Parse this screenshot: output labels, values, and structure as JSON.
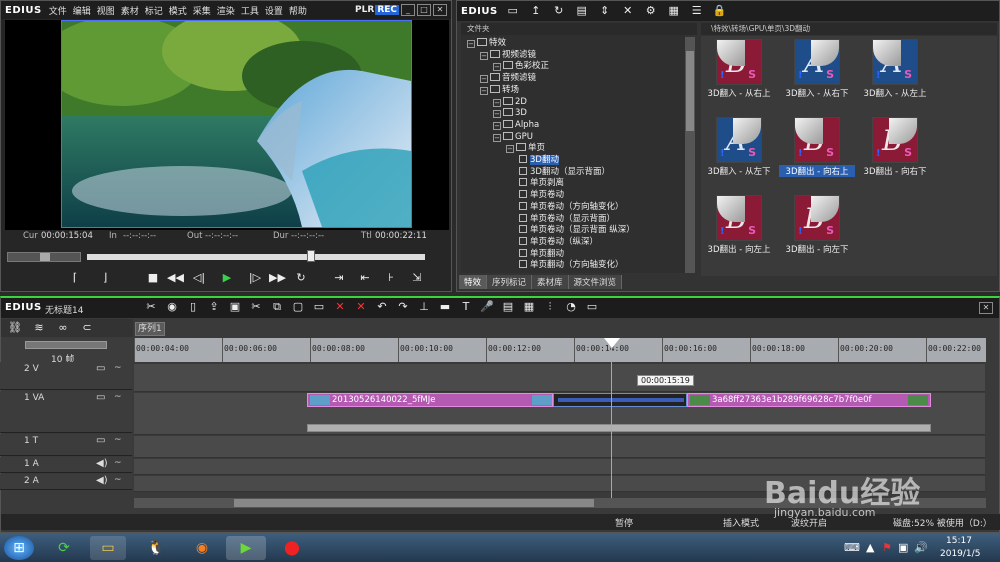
{
  "player": {
    "brand": "EDIUS",
    "menu": [
      "文件",
      "编辑",
      "视图",
      "素材",
      "标记",
      "模式",
      "采集",
      "渲染",
      "工具",
      "设置",
      "帮助"
    ],
    "plr": "PLR",
    "rec": "REC",
    "cur_label": "Cur",
    "cur": "00:00:15:04",
    "in_label": "In",
    "in": "--:--:--:--",
    "out_label": "Out",
    "out": "--:--:--:--",
    "dur_label": "Dur",
    "dur": "--:--:--:--",
    "ttl_label": "Ttl",
    "ttl": "00:00:22:11"
  },
  "bin": {
    "brand": "EDIUS",
    "folder_label": "文件夹",
    "path": "\\特效\\转场\\GPU\\单页\\3D翻动",
    "tree": [
      {
        "label": "特效",
        "depth": 0
      },
      {
        "label": "视频滤镜",
        "depth": 1
      },
      {
        "label": "色彩校正",
        "depth": 2
      },
      {
        "label": "音频滤镜",
        "depth": 1
      },
      {
        "label": "转场",
        "depth": 1
      },
      {
        "label": "2D",
        "depth": 2
      },
      {
        "label": "3D",
        "depth": 2
      },
      {
        "label": "Alpha",
        "depth": 2
      },
      {
        "label": "GPU",
        "depth": 2
      },
      {
        "label": "单页",
        "depth": 3
      },
      {
        "label": "3D翻动",
        "depth": 4,
        "sel": true
      },
      {
        "label": "3D翻动（显示背面）",
        "depth": 4
      },
      {
        "label": "单页剥离",
        "depth": 4
      },
      {
        "label": "单页卷动",
        "depth": 4
      },
      {
        "label": "单页卷动（方向轴变化）",
        "depth": 4
      },
      {
        "label": "单页卷动（显示背面）",
        "depth": 4
      },
      {
        "label": "单页卷动（显示背面 纵深）",
        "depth": 4
      },
      {
        "label": "单页卷动（纵深）",
        "depth": 4
      },
      {
        "label": "单页翻动",
        "depth": 4
      },
      {
        "label": "单页翻动（方向轴变化）",
        "depth": 4
      }
    ],
    "effects": [
      {
        "label": "3D翻入 - 从右上",
        "letter": "B",
        "variant": "red"
      },
      {
        "label": "3D翻入 - 从右下",
        "letter": "A",
        "variant": "blue"
      },
      {
        "label": "3D翻入 - 从左上",
        "letter": "A",
        "variant": "blue"
      },
      {
        "label": "3D翻入 - 从左下",
        "letter": "A",
        "variant": "blue"
      },
      {
        "label": "3D翻出 - 向右上",
        "letter": "B",
        "variant": "red",
        "sel": true
      },
      {
        "label": "3D翻出 - 向右下",
        "letter": "B",
        "variant": "red"
      },
      {
        "label": "3D翻出 - 向左上",
        "letter": "B",
        "variant": "red"
      },
      {
        "label": "3D翻出 - 向左下",
        "letter": "B",
        "variant": "red"
      }
    ],
    "tabs": [
      "特效",
      "序列标记",
      "素材库",
      "源文件浏览"
    ]
  },
  "timeline": {
    "brand": "EDIUS",
    "project": "无标题14",
    "sequence_tab": "序列1",
    "zoom": "10 帧",
    "ticks": [
      "00:00:04:00",
      "00:00:06:00",
      "00:00:08:00",
      "00:00:10:00",
      "00:00:12:00",
      "00:00:14:00",
      "00:00:16:00",
      "00:00:18:00",
      "00:00:20:00",
      "00:00:22:00"
    ],
    "cursor_tip": "00:00:15:19",
    "tracks": [
      "2 V",
      "1 VA",
      "1 T",
      "1 A",
      "2 A"
    ],
    "clip1": "20130526140022_5fMJe",
    "clip2": "3a68ff27363e1b289f69628c7b7f0e0f",
    "status": {
      "pause": "暂停",
      "insert": "插入模式",
      "ripple": "波纹开启",
      "disk": "磁盘:52% 被使用（D:）"
    }
  },
  "taskbar": {
    "time": "15:17",
    "date": "2019/1/5"
  },
  "watermark": {
    "main": "Baidu经验",
    "url": "jingyan.baidu.com"
  }
}
